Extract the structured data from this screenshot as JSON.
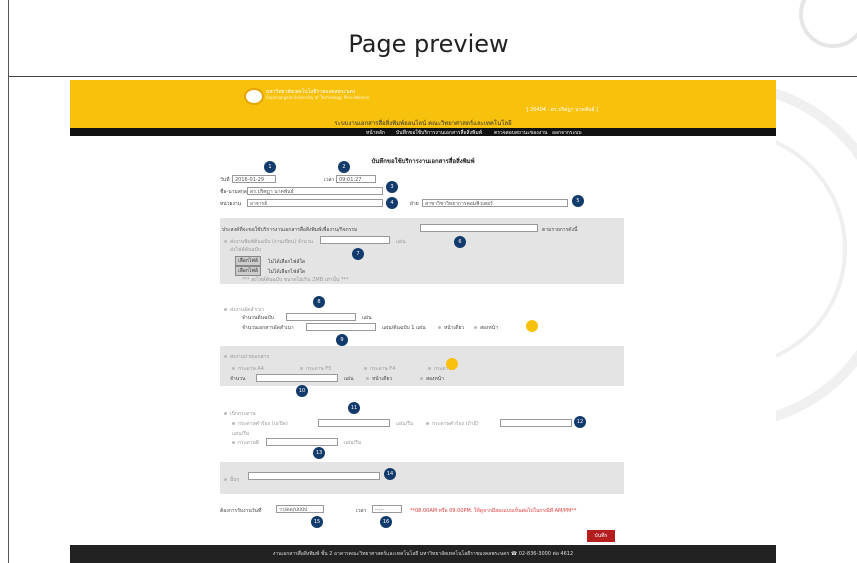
{
  "preview": {
    "title": "Page preview"
  },
  "header": {
    "university_th": "มหาวิทยาลัยเทคโนโลยีราชมงคลพระนคร",
    "university_en": "Rajamangala University of Technology Phra Nakhon",
    "user": "[ 20404 : ดร.ปริศฎา นาคพันธ์ ]",
    "system_title": "ระบบงานเอกสารสื่อสิ่งพิมพ์ออนไลน์ คณะวิทยาศาสตร์และเทคโนโลยี"
  },
  "nav": {
    "items": [
      "หน้าหลัก",
      "บันทึกขอใช้บริการงานเอกสารสื่อสิ่งพิมพ์",
      "ตรวจสอบสถานะของงาน",
      "ออกจากระบบ"
    ]
  },
  "form": {
    "title": "บันทึกขอใช้บริการงานเอกสารสื่อสิ่งพิมพ์",
    "date_label": "วันที่",
    "date_value": "2016-01-29",
    "time_label": "เวลา",
    "time_value": "09:01:27",
    "name_label": "ชื่อ-นามสกุล",
    "name_value": "ดร.ปริศฎา นาคพันธ์",
    "dept_label": "หน่วยงาน",
    "dept_value": "อาจารย์",
    "division_label": "ฝ่าย",
    "division_value": "สาขาวิชาวิทยาการคอมพิวเตอร์",
    "purpose_label": "ประสงค์ที่จะขอใช้บริการงานเอกสารสื่อสิ่งพิมพ์เพื่องาน/กิจกรรม",
    "purpose_suffix": "ตามรายการดังนี้",
    "print_file_label": "ส่งงานพิมพ์ต้นฉบับ (งานเขียน) จำนวน",
    "print_file_sub": "ส่งไฟล์ต้นฉบับ",
    "unit_sheet": "แผ่น",
    "choose_file": "เลือกไฟล์",
    "no_file": "ไม่ได้เลือกไฟล์ใด",
    "file_note": "*** ส่งไฟล์ต้นฉบับ ขนาดไม่เกิน 2MB เท่านั้น ***",
    "copy_label": "ส่งงานอัดสำเนา",
    "copy_master": "จำนวนต้นฉบับ",
    "copy_count": "จำนวนเอกสารอัดสำเนา",
    "copy_per": "แผ่น/ต้นฉบับ 1 แผ่น",
    "one_side": "หน้าเดียว",
    "two_side": "สองหน้า",
    "photocopy_label": "ส่งงานถ่ายเอกสาร",
    "paper_a4": "กระดาษ A4",
    "paper_f5": "กระดาษ F5",
    "paper_f4": "กระดาษ F4",
    "paper_other": "กระดาษสี",
    "amount_label": "จำนวน",
    "paper_req_label": "เบิกกระดาษ",
    "paper_white": "กระดาษคำร้อง (ปะปิด)",
    "paper_color": "กระดาษคำร้อง (ถ้ามี)",
    "per_ream": "แผ่น/รีม",
    "paper_colored": "กระดาษสี",
    "others_label": "อื่นๆ",
    "deadline_label": "ต้องการรับงานวันที่",
    "deadline_date_placeholder": "วว/ดด/ปปปป",
    "deadline_time_label": "เวลา",
    "deadline_time_placeholder": "--:--",
    "deadline_note": "**08.00AM หรือ 09.00PM. ให้ดูจากมีสองแบบเห็นต่อไปในกรณีที่ AM/PM**",
    "save_button": "บันทึก"
  },
  "badges": [
    "1",
    "2",
    "3",
    "4",
    "5",
    "6",
    "7",
    "8",
    "9",
    "10",
    "11",
    "12",
    "13",
    "14",
    "15",
    "16"
  ],
  "footer": {
    "text": "งานเอกสารสื่อสิ่งพิมพ์ ชั้น 2 อาคารคณะวิทยาศาสตร์และเทคโนโลยี มหาวิทยาลัยเทคโนโลยีราชมงคลพระนคร  ☎ 02-836-3000 ต่อ 4612"
  },
  "colors": {
    "accent": "#f8c10c",
    "badge": "#123a6b",
    "save": "#b51e1e"
  }
}
